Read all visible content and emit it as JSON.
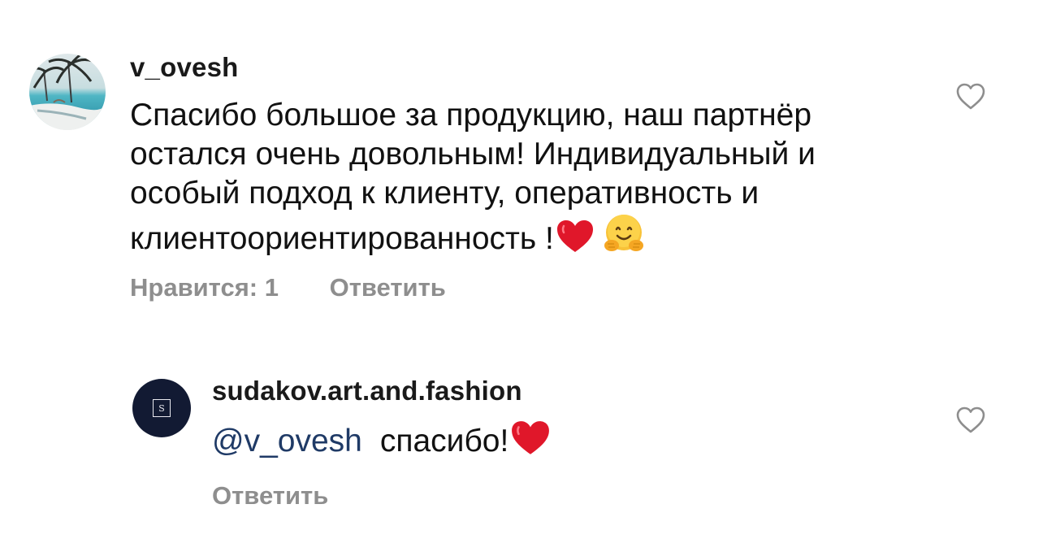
{
  "comments": [
    {
      "username": "v_ovesh",
      "text": "Спасибо большое за продукцию, наш партнёр остался очень довольным! Индивидуальный и особый подход к клиенту, оперативность и клиентоориентированность !",
      "emojis": [
        "red-heart",
        "hugging-face"
      ],
      "likes": "Нравится: 1",
      "reply": "Ответить"
    },
    {
      "username": "sudakov.art.and.fashion",
      "avatar_letter": "S",
      "mention": "@v_ovesh",
      "text": "спасибо!",
      "emojis": [
        "red-heart"
      ],
      "reply": "Ответить"
    }
  ],
  "colors": {
    "text": "#111111",
    "muted": "#8e8e8e",
    "mention": "#1f3a66",
    "heart": "#e0172a",
    "brand_avatar": "#121a33"
  }
}
